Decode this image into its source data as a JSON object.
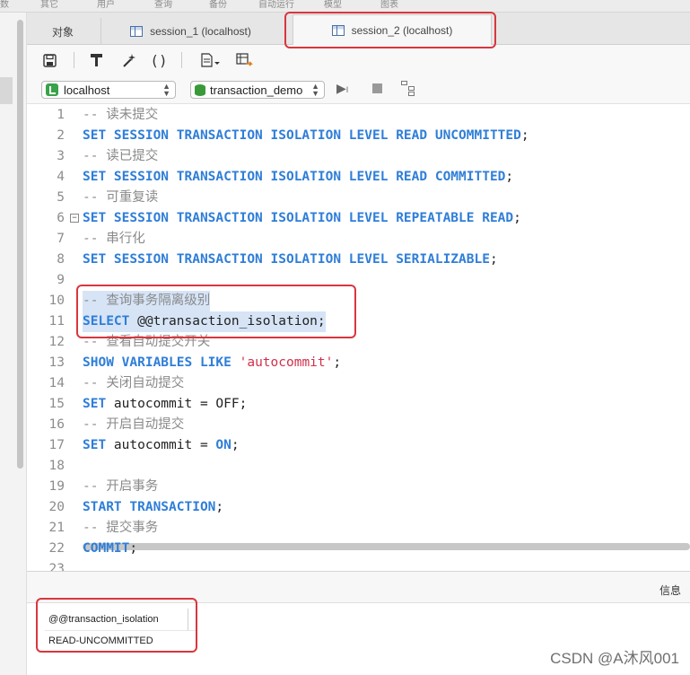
{
  "menu": {
    "items": [
      "数",
      "其它",
      "用户",
      "查询",
      "备份",
      "自动运行",
      "模型",
      "图表"
    ]
  },
  "tabs": {
    "object": "对象",
    "session1": "session_1 (localhost)",
    "session2": "session_2 (localhost)"
  },
  "toolbar": {
    "save_icon": "save-icon",
    "format_icon": "format-icon",
    "beautify_icon": "magic-wand-icon",
    "paren_label": "()",
    "snippet_icon": "document-icon",
    "export_icon": "table-export-icon"
  },
  "connection": {
    "server": "localhost",
    "database": "transaction_demo"
  },
  "editor": {
    "lines": [
      {
        "n": "1",
        "parts": [
          [
            "cm",
            "-- 读未提交"
          ]
        ]
      },
      {
        "n": "2",
        "parts": [
          [
            "kw",
            "SET SESSION TRANSACTION ISOLATION LEVEL READ UNCOMMITTED"
          ],
          [
            "plain",
            ";"
          ]
        ]
      },
      {
        "n": "3",
        "parts": [
          [
            "cm",
            "-- 读已提交"
          ]
        ]
      },
      {
        "n": "4",
        "parts": [
          [
            "kw",
            "SET SESSION TRANSACTION ISOLATION LEVEL READ COMMITTED"
          ],
          [
            "plain",
            ";"
          ]
        ]
      },
      {
        "n": "5",
        "parts": [
          [
            "cm",
            "-- 可重复读"
          ]
        ]
      },
      {
        "n": "6",
        "fold": true,
        "parts": [
          [
            "kw",
            "SET SESSION TRANSACTION ISOLATION LEVEL REPEATABLE READ"
          ],
          [
            "plain",
            ";"
          ]
        ]
      },
      {
        "n": "7",
        "parts": [
          [
            "cm",
            "-- 串行化"
          ]
        ]
      },
      {
        "n": "8",
        "parts": [
          [
            "kw",
            "SET SESSION TRANSACTION ISOLATION LEVEL SERIALIZABLE"
          ],
          [
            "plain",
            ";"
          ]
        ]
      },
      {
        "n": "9",
        "parts": []
      },
      {
        "n": "10",
        "highlight": true,
        "parts": [
          [
            "cm",
            "-- 查询事务隔离级别"
          ]
        ]
      },
      {
        "n": "11",
        "highlight": true,
        "parts": [
          [
            "kw",
            "SELECT"
          ],
          [
            "plain",
            " @@transaction_isolation;"
          ]
        ]
      },
      {
        "n": "12",
        "parts": [
          [
            "cm",
            "-- 查看自动提交开关"
          ]
        ]
      },
      {
        "n": "13",
        "parts": [
          [
            "kw",
            "SHOW VARIABLES LIKE"
          ],
          [
            "plain",
            " "
          ],
          [
            "str",
            "'autocommit'"
          ],
          [
            "plain",
            ";"
          ]
        ]
      },
      {
        "n": "14",
        "parts": [
          [
            "cm",
            "-- 关闭自动提交"
          ]
        ]
      },
      {
        "n": "15",
        "parts": [
          [
            "kw",
            "SET"
          ],
          [
            "plain",
            " autocommit = OFF;"
          ]
        ]
      },
      {
        "n": "16",
        "parts": [
          [
            "cm",
            "-- 开启自动提交"
          ]
        ]
      },
      {
        "n": "17",
        "parts": [
          [
            "kw",
            "SET"
          ],
          [
            "plain",
            " autocommit = "
          ],
          [
            "kw",
            "ON"
          ],
          [
            "plain",
            ";"
          ]
        ]
      },
      {
        "n": "18",
        "parts": []
      },
      {
        "n": "19",
        "parts": [
          [
            "cm",
            "-- 开启事务"
          ]
        ]
      },
      {
        "n": "20",
        "parts": [
          [
            "kw",
            "START TRANSACTION"
          ],
          [
            "plain",
            ";"
          ]
        ]
      },
      {
        "n": "21",
        "parts": [
          [
            "cm",
            "-- 提交事务"
          ]
        ]
      },
      {
        "n": "22",
        "parts": [
          [
            "kw",
            "COMMIT"
          ],
          [
            "plain",
            ";"
          ]
        ]
      },
      {
        "n": "23",
        "parts": []
      }
    ]
  },
  "result": {
    "info_tab": "信息",
    "column": "@@transaction_isolation",
    "value": "READ-UNCOMMITTED"
  },
  "watermark": "CSDN @A沐风001",
  "colors": {
    "keyword": "#2f7ed8",
    "comment": "#8a8a8a",
    "string": "#d0304a",
    "annotation": "#d9363e"
  }
}
